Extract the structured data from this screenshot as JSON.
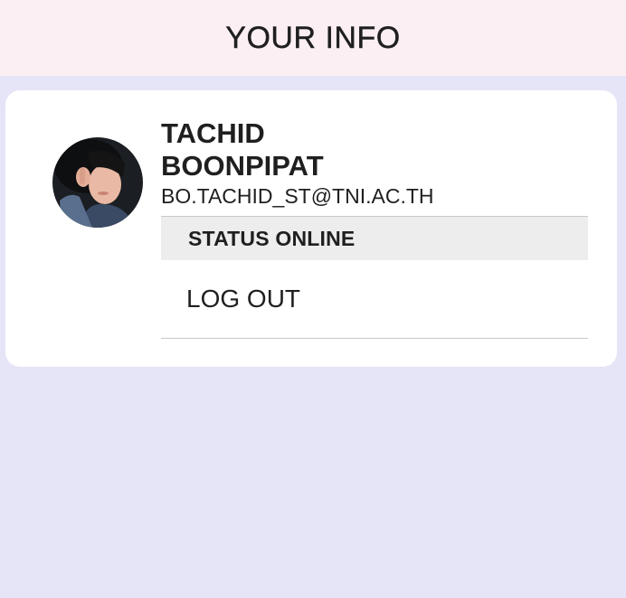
{
  "header": {
    "title": "YOUR INFO"
  },
  "profile": {
    "first_name": "TACHID",
    "last_name": "BOONPIPAT",
    "email": "BO.TACHID_ST@TNI.AC.TH",
    "avatar_icon": "profile-photo"
  },
  "status": {
    "label": "STATUS ONLINE"
  },
  "actions": {
    "logout_label": "LOG OUT"
  },
  "colors": {
    "background": "#e6e4f7",
    "header_background": "#fbeff4",
    "card_background": "#ffffff",
    "status_background": "#ededed",
    "divider": "#c9c9c9",
    "text": "#1f1f1f"
  }
}
